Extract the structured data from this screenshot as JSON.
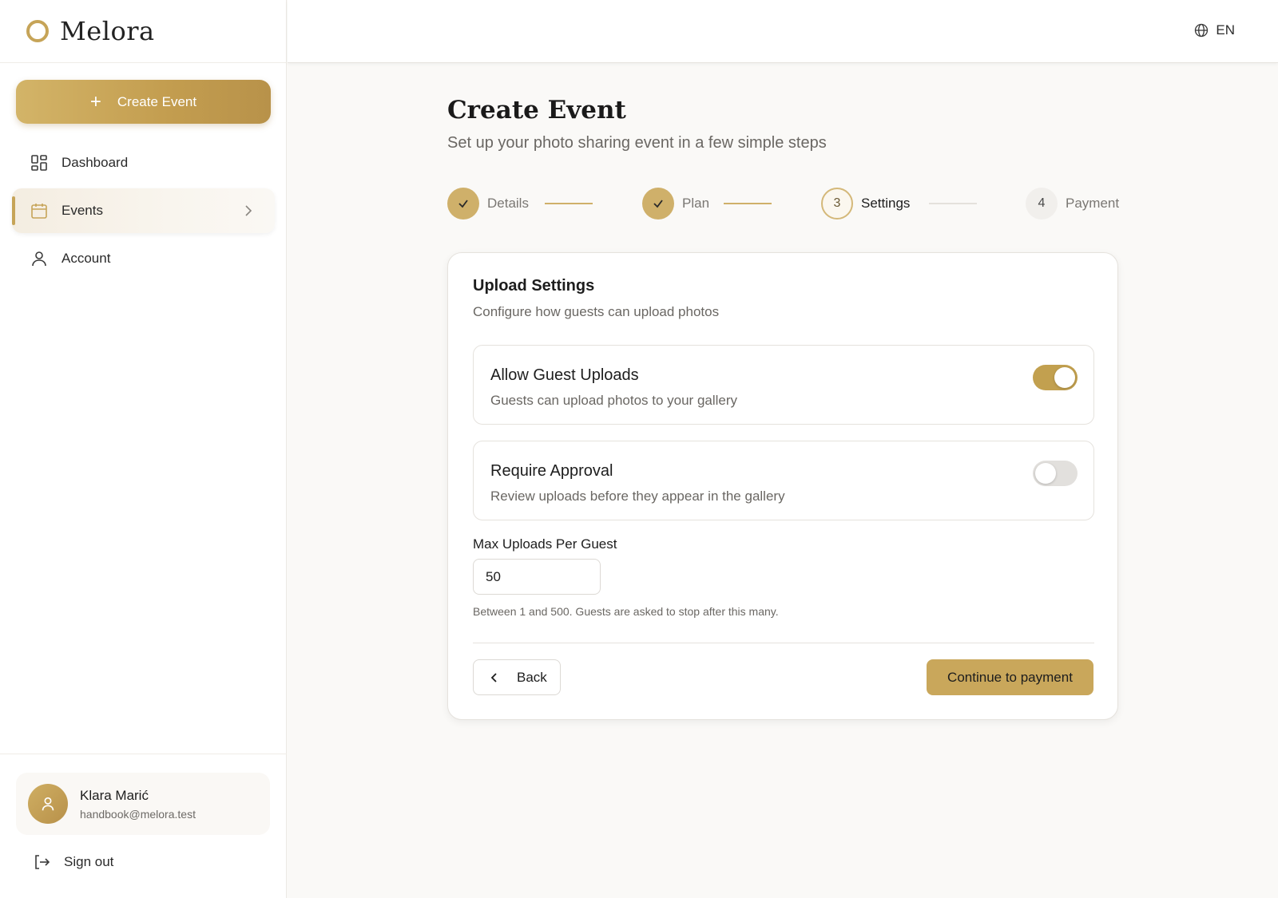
{
  "brand": {
    "name": "Melora",
    "accent": "#c6a458"
  },
  "sidebar": {
    "create_label": "Create Event",
    "items": [
      {
        "label": "Dashboard",
        "icon": "dashboard-icon"
      },
      {
        "label": "Events",
        "icon": "calendar-icon",
        "active": true
      },
      {
        "label": "Account",
        "icon": "user-icon"
      }
    ],
    "user": {
      "name": "Klara Marić",
      "email": "handbook@melora.test"
    },
    "signout_label": "Sign out"
  },
  "topbar": {
    "language": "EN"
  },
  "main": {
    "title": "Create Event",
    "subtitle": "Set up your photo sharing event in a few simple steps"
  },
  "stepper": {
    "steps": [
      {
        "label": "Details",
        "status": "done"
      },
      {
        "label": "Plan",
        "status": "done"
      },
      {
        "number": "3",
        "label": "Settings",
        "status": "current"
      },
      {
        "number": "4",
        "label": "Payment",
        "status": "todo"
      }
    ]
  },
  "card": {
    "title": "Upload Settings",
    "subtitle": "Configure how guests can upload photos",
    "options": [
      {
        "title": "Allow Guest Uploads",
        "description": "Guests can upload photos to your gallery",
        "enabled": true
      },
      {
        "title": "Require Approval",
        "description": "Review uploads before they appear in the gallery",
        "enabled": false
      }
    ],
    "max_uploads": {
      "label": "Max Uploads Per Guest",
      "value": "50",
      "help": "Between 1 and 500. Guests are asked to stop after this many."
    },
    "back_label": "Back",
    "continue_label": "Continue to payment"
  }
}
